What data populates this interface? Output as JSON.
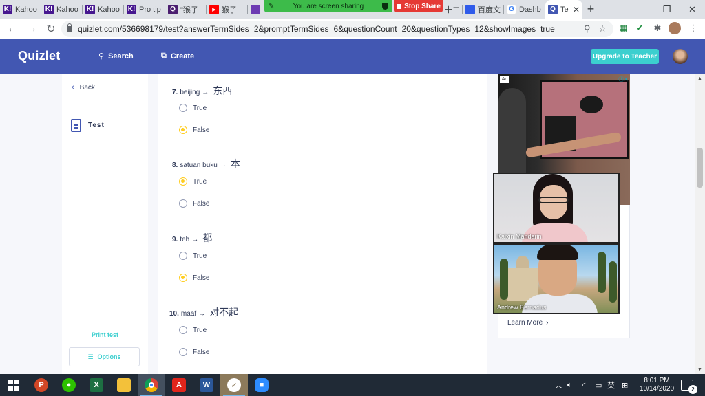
{
  "browser": {
    "tabs": [
      {
        "label": "Kahoo",
        "favicon": "K!",
        "color": "#46178f"
      },
      {
        "label": "Kahoo",
        "favicon": "K!",
        "color": "#46178f"
      },
      {
        "label": "Kahoo",
        "favicon": "K!",
        "color": "#46178f"
      },
      {
        "label": "Pro tip",
        "favicon": "K!",
        "color": "#46178f"
      },
      {
        "label": "\"猴子",
        "favicon": "Q",
        "color": "#4a1d6f"
      },
      {
        "label": "猴子",
        "favicon": "▶",
        "color": "#ff0000"
      },
      {
        "label": "",
        "favicon": "",
        "color": "#6d3bb3"
      },
      {
        "label": "十二",
        "favicon": "",
        "color": "#1a73e8"
      },
      {
        "label": "百度文",
        "favicon": "",
        "color": "#2f5bea"
      },
      {
        "label": "Dashb",
        "favicon": "G",
        "color": "#4285f4"
      },
      {
        "label": "Te",
        "favicon": "Q",
        "color": "#4257b2",
        "active": true
      }
    ],
    "url": "quizlet.com/536698179/test?answerTermSides=2&promptTermSides=6&questionCount=20&questionTypes=12&showImages=true"
  },
  "sharing": {
    "message": "You are screen sharing",
    "stop_label": "Stop Share"
  },
  "quizlet": {
    "logo": "Quizlet",
    "search_label": "Search",
    "create_label": "Create",
    "upgrade_label": "Upgrade to Teacher"
  },
  "sidebar": {
    "back_label": "Back",
    "test_label": "Test",
    "print_label": "Print test",
    "options_label": "Options"
  },
  "questions": [
    {
      "number": "7.",
      "term": "beijing",
      "answer": "东西",
      "options": [
        "True",
        "False"
      ],
      "selected": 1
    },
    {
      "number": "8.",
      "term": "satuan buku",
      "answer": "本",
      "options": [
        "True",
        "False"
      ],
      "selected": 0
    },
    {
      "number": "9.",
      "term": "teh",
      "answer": "都",
      "options": [
        "True",
        "False"
      ],
      "selected": 1
    },
    {
      "number": "10.",
      "term": "maaf",
      "answer": "对不起",
      "options": [
        "True",
        "False"
      ],
      "selected": null
    }
  ],
  "ad": {
    "badge": "Ad",
    "learn_more": "Learn More"
  },
  "video": {
    "participant_1": "Kaixin Mandarin",
    "participant_2": "Andrew Bernadus"
  },
  "taskbar": {
    "ime_label": "英",
    "time": "8:01 PM",
    "date": "10/14/2020",
    "notification_count": "2"
  }
}
